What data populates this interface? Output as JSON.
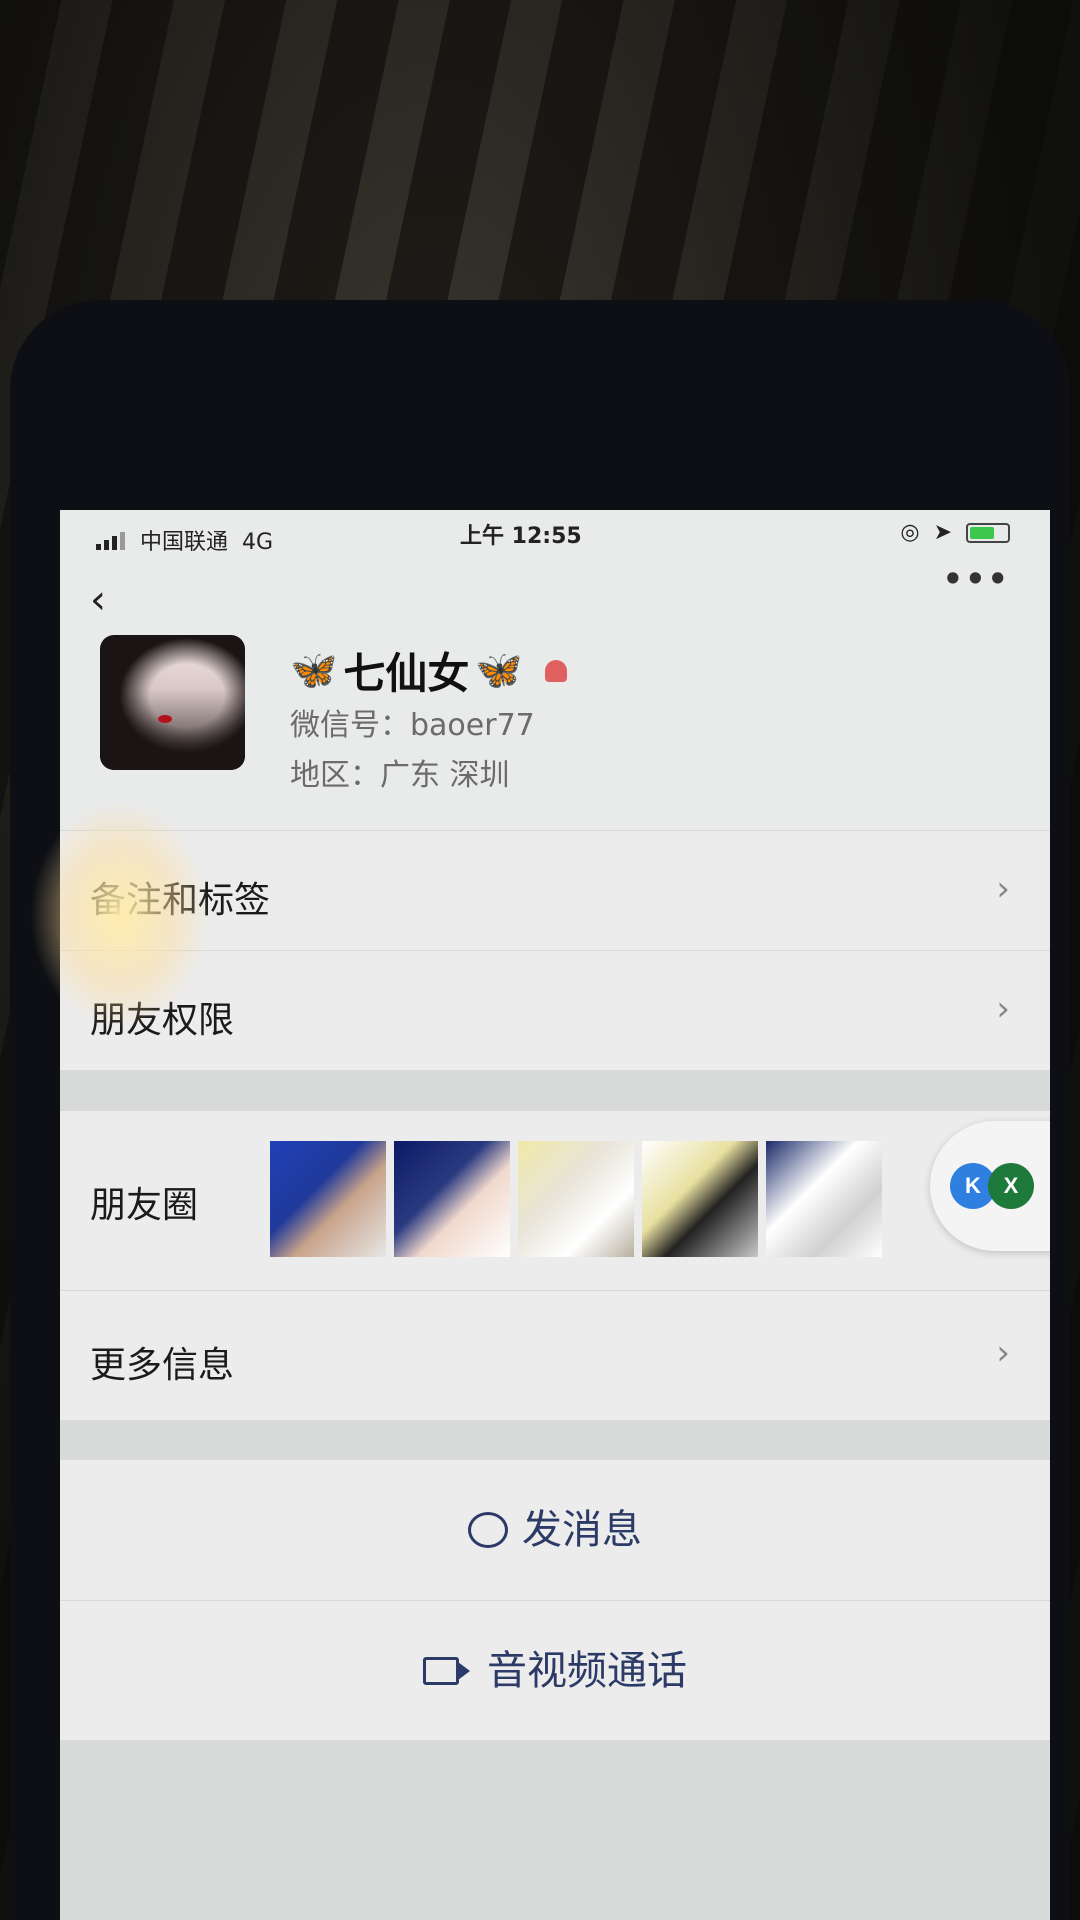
{
  "status_bar": {
    "carrier": "中国联通",
    "network": "4G",
    "time": "上午 12:55"
  },
  "nav": {
    "back_glyph": "‹",
    "more_glyph": "•••"
  },
  "profile": {
    "name": "七仙女",
    "wechat_id": "微信号：baoer77",
    "region": "地区：广东 深圳",
    "name_decoration": "🦋"
  },
  "rows": {
    "remark_tags": "备注和标签",
    "friend_permissions": "朋友权限",
    "moments": "朋友圈",
    "more_info": "更多信息"
  },
  "actions": {
    "send_message": "发消息",
    "av_call": "音视频通话"
  },
  "floating": {
    "icon_a": "K",
    "icon_b": "X"
  },
  "colors": {
    "accent": "#2b3a66",
    "background": "#e9eaea",
    "butterfly": "#1b8fe6"
  }
}
